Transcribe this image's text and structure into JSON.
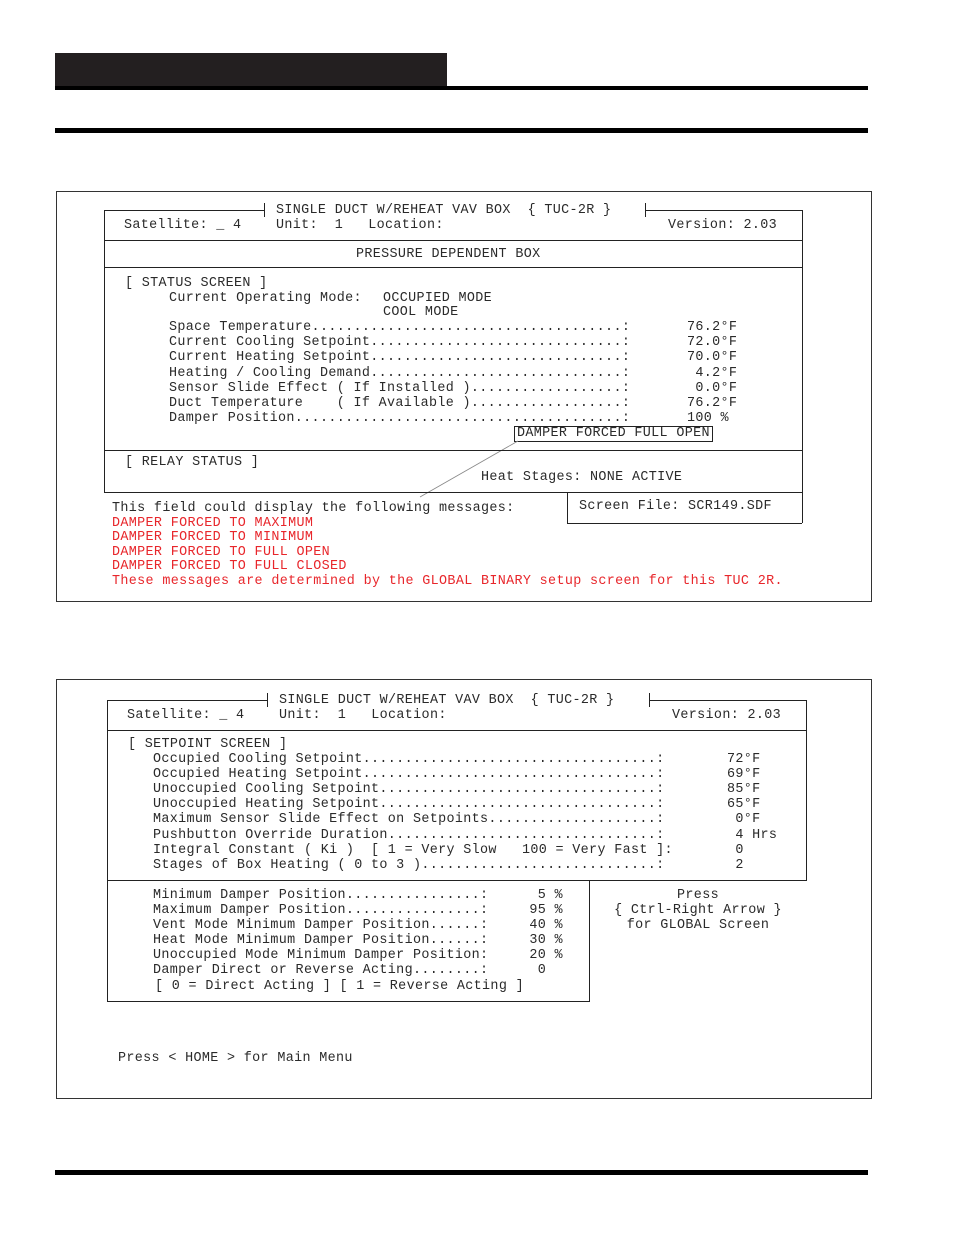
{
  "page_header": {
    "block_color": "#231f20"
  },
  "status_figure": {
    "title": "SINGLE DUCT W/REHEAT VAV BOX  { TUC-2R }",
    "satellite_label": "Satellite: _ 4",
    "unit_location": "Unit:  1   Location:",
    "version": "Version: 2.03",
    "box_type": "PRESSURE DEPENDENT BOX",
    "section_title": "[ STATUS SCREEN ]",
    "operating_mode_label": "Current Operating Mode:",
    "operating_mode_values": [
      "OCCUPIED MODE",
      "COOL MODE"
    ],
    "rows": [
      {
        "label": "Space Temperature.....................................:",
        "value": "76.2°F"
      },
      {
        "label": "Current Cooling Setpoint..............................:",
        "value": "72.0°F"
      },
      {
        "label": "Current Heating Setpoint..............................:",
        "value": "70.0°F"
      },
      {
        "label": "Heating / Cooling Demand..............................:",
        "value": " 4.2°F"
      },
      {
        "label": "Sensor Slide Effect ( If Installed )..................:",
        "value": " 0.0°F"
      },
      {
        "label": "Duct Temperature    ( If Available )..................:",
        "value": "76.2°F"
      },
      {
        "label": "Damper Position.......................................:",
        "value": "100 %"
      }
    ],
    "damper_message": "DAMPER FORCED FULL OPEN",
    "relay_title": "[ RELAY STATUS ]",
    "heat_stages": "Heat Stages: NONE ACTIVE",
    "annotation_intro": "This field could display the following messages:",
    "screen_file": "Screen File: SCR149.SDF",
    "annotation_messages": [
      "DAMPER FORCED TO MAXIMUM",
      "DAMPER FORCED TO MINIMUM",
      "DAMPER FORCED TO FULL OPEN",
      "DAMPER FORCED TO FULL CLOSED",
      "These messages are determined by the GLOBAL BINARY setup screen for this TUC 2R."
    ],
    "annotation_color": "#e8262b"
  },
  "setpoint_figure": {
    "title": "SINGLE DUCT W/REHEAT VAV BOX  { TUC-2R }",
    "satellite_label": "Satellite: _ 4",
    "unit_location": "Unit:  1   Location:",
    "version": "Version: 2.03",
    "section_title": "[ SETPOINT SCREEN ]",
    "rows": [
      {
        "label": "Occupied Cooling Setpoint...................................:",
        "value": "72°F"
      },
      {
        "label": "Occupied Heating Setpoint...................................:",
        "value": "69°F"
      },
      {
        "label": "Unoccupied Cooling Setpoint.................................:",
        "value": "85°F"
      },
      {
        "label": "Unoccupied Heating Setpoint.................................:",
        "value": "65°F"
      },
      {
        "label": "Maximum Sensor Slide Effect on Setpoints....................:",
        "value": " 0°F"
      },
      {
        "label": "Pushbutton Override Duration................................:",
        "value": " 4 Hrs"
      },
      {
        "label": "Integral Constant ( Ki )  [ 1 = Very Slow   100 = Very Fast ]:",
        "value": " 0"
      },
      {
        "label": "Stages of Box Heating ( 0 to 3 )............................:",
        "value": " 2"
      }
    ],
    "damper_rows": [
      {
        "label": "Minimum Damper Position................:",
        "value": "  5 %"
      },
      {
        "label": "Maximum Damper Position................:",
        "value": " 95 %"
      },
      {
        "label": "Vent Mode Minimum Damper Position......:",
        "value": " 40 %"
      },
      {
        "label": "Heat Mode Minimum Damper Position......:",
        "value": " 30 %"
      },
      {
        "label": "Unoccupied Mode Minimum Damper Position:",
        "value": " 20 %"
      },
      {
        "label": "Damper Direct or Reverse Acting........:",
        "value": "  0"
      }
    ],
    "acting_legend": "[ 0 = Direct Acting ] [ 1 = Reverse Acting ]",
    "global_hint": [
      "Press",
      "{ Ctrl-Right Arrow }",
      "for GLOBAL Screen"
    ],
    "home_hint": "Press < HOME > for Main Menu"
  }
}
